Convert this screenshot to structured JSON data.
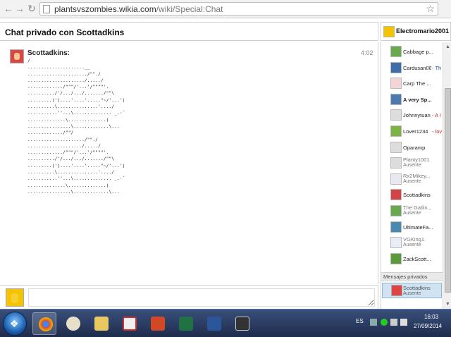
{
  "browser": {
    "url_host": "plantsvszombies.wikia.com",
    "url_path": "/wiki/Special:Chat"
  },
  "chat": {
    "title": "Chat privado con Scottadkins",
    "current_user": "Electromario2001",
    "message": {
      "user": "Scottadkins:",
      "time": "4:02",
      "text": "/\n.....................__\n....................../\"\"./\n...................../...../\n............./\"\"\"/'...'/\"\"\"\"'.\n........../'/.../.../......./\"\"\\\n.........('(....'....'.....\"~/'...')\n..........\\...............'..../\n...........''...\\.............. _.·´\n..............\\..............(\n................\\.............\\...\n............./\"\"/\n...................../\"\"./\n..................../...../\n............./\"\"\"/'...'/\"\"\"\"'.\n........../'/.../.../......./\"\"\\\n.........('(....'....'.....\"~/'...')\n..........\\...............'..../\n...........''...\\.............. _.·´\n..............\\..............(\n................\\.............\\..."
    },
    "input_placeholder": ""
  },
  "sidebar": {
    "users": [
      {
        "name": "Cabbage p...",
        "status": "",
        "extra": "",
        "bold": false,
        "away": false,
        "color": "#6aa84f"
      },
      {
        "name": "Cardusan08",
        "status": "",
        "extra": "- Th",
        "extra_color": "#1f4f9f",
        "bold": false,
        "away": false,
        "color": "#3d6ea8"
      },
      {
        "name": "Carp The ...",
        "status": "",
        "extra": "",
        "bold": false,
        "away": false,
        "color": "#f4d4d4"
      },
      {
        "name": "A very Sp...",
        "status": "",
        "extra": "",
        "bold": true,
        "away": false,
        "color": "#4c7ab0"
      },
      {
        "name": "Johnnytuan",
        "status": "",
        "extra": "- A I",
        "extra_color": "#cc2222",
        "bold": false,
        "away": false,
        "color": "#dddddd"
      },
      {
        "name": "Lover1234",
        "status": "",
        "extra": "- lov",
        "extra_color": "#cc2222",
        "bold": false,
        "away": false,
        "color": "#7cb342"
      },
      {
        "name": "Oparamp",
        "status": "",
        "extra": "",
        "bold": false,
        "away": false,
        "color": "#dddddd"
      },
      {
        "name": "Planty1001",
        "status": "Ausente",
        "extra": "",
        "bold": false,
        "away": true,
        "color": "#dddddd"
      },
      {
        "name": "Rx2Mikey...",
        "status": "Ausente",
        "extra": "",
        "bold": false,
        "away": true,
        "color": "#e8e8f0"
      },
      {
        "name": "Scottadkins",
        "status": "",
        "extra": "",
        "bold": false,
        "away": false,
        "color": "#d44444"
      },
      {
        "name": "The Gatlin...",
        "status": "Ausente",
        "extra": "",
        "bold": false,
        "away": true,
        "color": "#6aa84f"
      },
      {
        "name": "UltimateFa...",
        "status": "",
        "extra": "",
        "bold": false,
        "away": false,
        "color": "#4a8ab0"
      },
      {
        "name": "VGKing1",
        "status": "Ausente",
        "extra": "",
        "bold": false,
        "away": true,
        "color": "#e8eef8"
      },
      {
        "name": "ZackScott...",
        "status": "",
        "extra": "",
        "bold": false,
        "away": false,
        "color": "#5a9a3a"
      }
    ],
    "private_header": "Mensajes privados",
    "private_chat": {
      "name": "Scottadkins",
      "status": "Ausente"
    }
  },
  "taskbar": {
    "language": "ES",
    "time": "16:03",
    "date": "27/09/2014"
  }
}
